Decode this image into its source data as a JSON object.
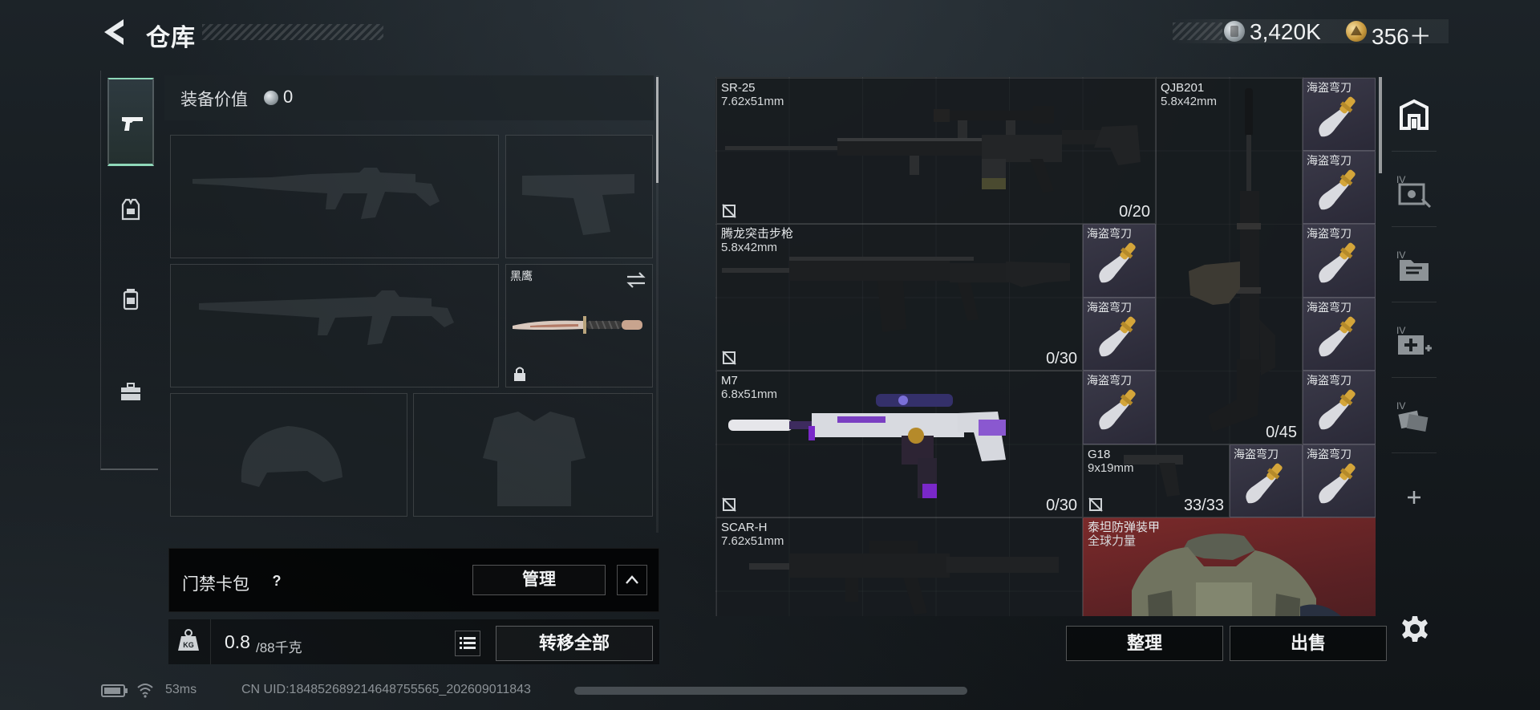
{
  "header": {
    "title": "仓库",
    "currency": {
      "silver": "3,420K",
      "gold": "356＋"
    }
  },
  "tabs": [
    {
      "name": "weapons",
      "icon": "pistol-icon",
      "active": true
    },
    {
      "name": "equipment",
      "icon": "vest-icon",
      "active": false
    },
    {
      "name": "backpack",
      "icon": "backpack-icon",
      "active": false
    },
    {
      "name": "case",
      "icon": "briefcase-icon",
      "active": false
    }
  ],
  "loadout": {
    "value_label": "装备价值",
    "value": "0",
    "melee": {
      "name": "黑鹰",
      "locked": true
    },
    "keycard_label": "门禁卡包",
    "help_symbol": "?",
    "manage_label": "管理",
    "weight_current": "0.8",
    "weight_max": "/88千克",
    "weight_icon_text": "KG",
    "transfer_label": "转移全部"
  },
  "storage": {
    "items": [
      {
        "name": "SR-25",
        "caliber": "7.62x51mm",
        "ammo": "0/20"
      },
      {
        "name": "QJB201",
        "caliber": "5.8x42mm",
        "ammo": "0/45"
      },
      {
        "name": "腾龙突击步枪",
        "caliber": "5.8x42mm",
        "ammo": "0/30"
      },
      {
        "name": "M7",
        "caliber": "6.8x51mm",
        "ammo": "0/30"
      },
      {
        "name": "G18",
        "caliber": "9x19mm",
        "ammo": "33/33"
      },
      {
        "name": "SCAR-H",
        "caliber": "7.62x51mm",
        "ammo": ""
      },
      {
        "name": "泰坦防弹装甲",
        "caliber": "全球力量",
        "ammo": ""
      }
    ],
    "knife_name": "海盗弯刀",
    "knife_count": 11,
    "sort_label": "整理",
    "sell_label": "出售",
    "side_tabs": [
      "all-items-icon",
      "tier-iv-case-icon",
      "tier-iv-folder-icon",
      "tier-iv-medkit-icon",
      "tier-iv-cards-icon",
      "add-tab-icon"
    ]
  },
  "status": {
    "ping": "53ms",
    "uid": "CN UID:18485268921464875556​5_202609011843"
  },
  "colors": {
    "accent": "#8fd8b9",
    "knife_bg": "#3a3948",
    "armor_bg": "#6b2526",
    "gold": "#c99a3e"
  }
}
